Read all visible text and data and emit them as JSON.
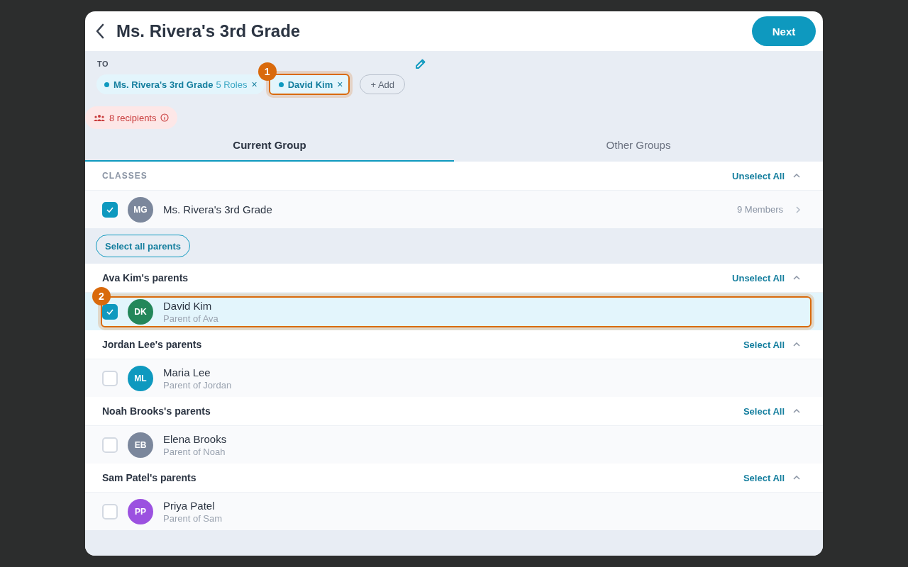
{
  "header": {
    "title": "Ms. Rivera's 3rd Grade",
    "next_button": "Next"
  },
  "to": {
    "label": "TO",
    "chips": [
      {
        "name": "Ms. Rivera's 3rd Grade",
        "detail": "5 Roles",
        "remove": "×"
      },
      {
        "name": "David Kim",
        "remove": "×",
        "callout": "1"
      }
    ],
    "add_button": "+ Add"
  },
  "recipients": {
    "text": "8 recipients"
  },
  "tabs": [
    {
      "label": "Current Group",
      "selected": true
    },
    {
      "label": "Other Groups",
      "selected": false
    }
  ],
  "classes": {
    "heading": "CLASSES",
    "action": "Unselect All",
    "expanded": true,
    "items": [
      {
        "initials": "MG",
        "name": "Ms. Rivera's 3rd Grade",
        "meta": "9 Members",
        "color": "#7b879c",
        "checked": true
      }
    ]
  },
  "select_all_parents": "Select all parents",
  "groups": [
    {
      "heading": "Ava Kim's parents",
      "action": "Unselect All",
      "expanded": true,
      "members": [
        {
          "initials": "DK",
          "name": "David Kim",
          "subtitle": "Parent of Ava",
          "color": "#23875a",
          "checked": true,
          "callout": "2"
        }
      ]
    },
    {
      "heading": "Jordan Lee's parents",
      "action": "Select All",
      "expanded": true,
      "members": [
        {
          "initials": "ML",
          "name": "Maria Lee",
          "subtitle": "Parent of Jordan",
          "color": "#0e99bf",
          "checked": false
        }
      ]
    },
    {
      "heading": "Noah Brooks's parents",
      "action": "Select All",
      "expanded": true,
      "members": [
        {
          "initials": "EB",
          "name": "Elena Brooks",
          "subtitle": "Parent of Noah",
          "color": "#7b879c",
          "checked": false
        }
      ]
    },
    {
      "heading": "Sam Patel's parents",
      "action": "Select All",
      "expanded": true,
      "members": [
        {
          "initials": "PP",
          "name": "Priya Patel",
          "subtitle": "Parent of Sam",
          "color": "#9b51e0",
          "checked": false
        }
      ]
    }
  ]
}
